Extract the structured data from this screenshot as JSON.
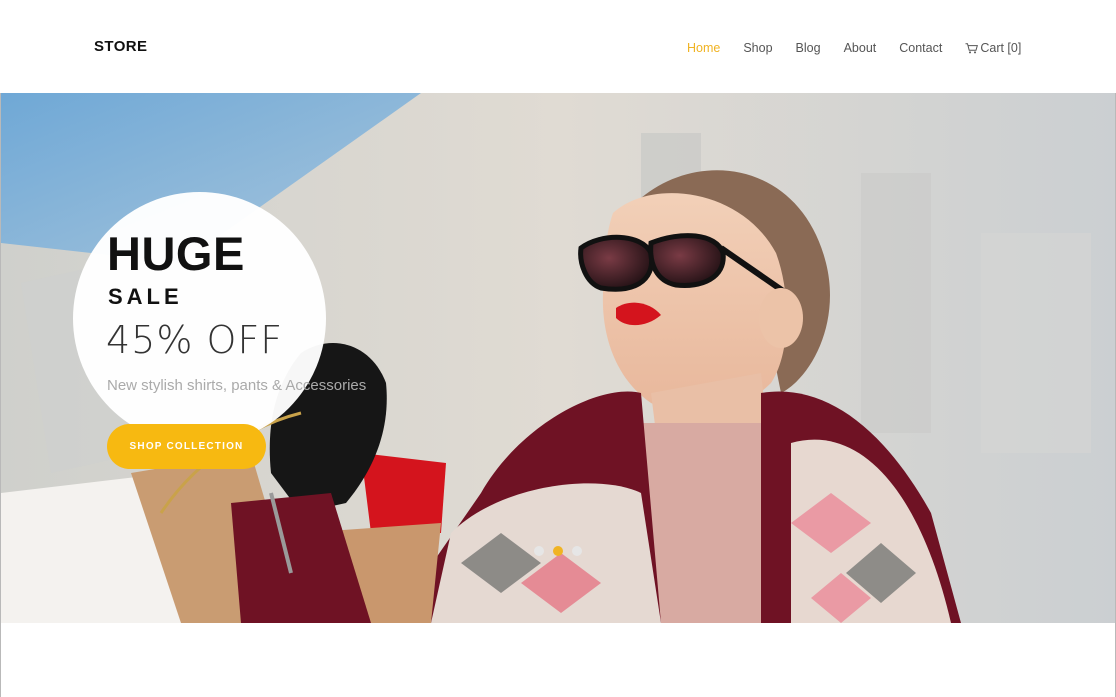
{
  "header": {
    "logo": "STORE",
    "nav": [
      {
        "label": "Home",
        "active": true
      },
      {
        "label": "Shop",
        "active": false
      },
      {
        "label": "Blog",
        "active": false
      },
      {
        "label": "About",
        "active": false
      },
      {
        "label": "Contact",
        "active": false
      }
    ],
    "cart_label": "Cart [0]"
  },
  "hero": {
    "headline": "HUGE",
    "subheadline": "SALE",
    "discount": "45% OFF",
    "tagline": "New stylish shirts, pants & Accessories",
    "cta_label": "SHOP COLLECTION",
    "slides": {
      "count": 3,
      "active_index": 1
    }
  },
  "colors": {
    "accent": "#f0b323",
    "button": "#f7b911",
    "nav_text": "#555555"
  }
}
